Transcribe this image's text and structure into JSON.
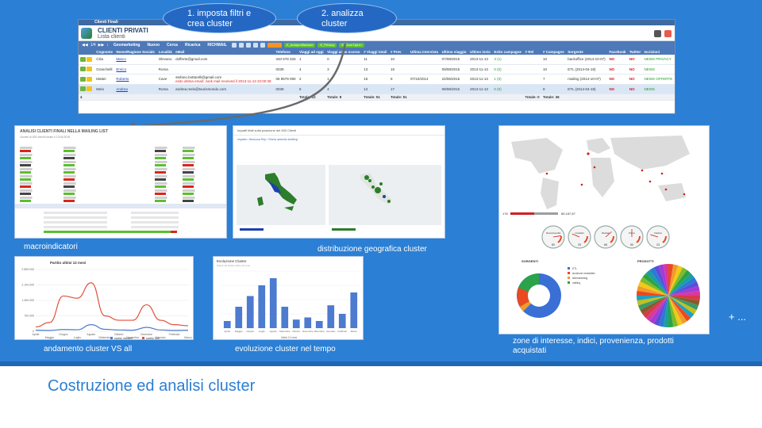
{
  "callouts": {
    "step1": "1. imposta filtri e crea cluster",
    "step2": "2. analizza cluster"
  },
  "crm": {
    "window_title": "Clienti Finali",
    "heading": "CLIENTI PRIVATI",
    "subheading": "Lista clienti",
    "toolbar": {
      "count": "1/4",
      "items": [
        "Geomarketing",
        "Nuovo",
        "Cerca",
        "Ricarica",
        "RICHMAIL"
      ],
      "buttons": [
        "E_Autoprofilazione",
        "E_Privacy",
        "E_Dual Opt-in"
      ]
    },
    "columns": [
      "Cognome",
      "Nome/Ragione Sociale",
      "Località",
      "eMail",
      "Telefono",
      "Viaggi ad oggi",
      "Viaggi anno scorso",
      "# Viaggi totali",
      "# Prev",
      "Ultima intervista",
      "Ultimo viaggio",
      "Ultimo invio",
      "Esito campagne",
      "# Rel",
      "# Campagne",
      "Sorgente",
      "Facebook",
      "Twitter",
      "Iscrizioni"
    ],
    "rows": [
      {
        "cognome": "Cilia",
        "nome": "Marco",
        "localita": "Olevano",
        "email": "dofferte@gmail.com",
        "email2": "",
        "telefono": "340 678 333",
        "oggi": "1",
        "scorso": "0",
        "totali": "11",
        "prev": "10",
        "intervista": "",
        "ultimo_viaggio": "07/08/2015",
        "ultimo_invio": "2013-11-13",
        "esito": "3 (1)",
        "rel": "",
        "campagne": "10",
        "sorgente": "backoffice (2014-10-07)",
        "facebook": "NO",
        "twitter": "NO",
        "iscrizioni": "NEWS PRIVACY"
      },
      {
        "cognome": "Granchelli",
        "nome": "Enrico",
        "localita": "Roma",
        "email": "",
        "email2": "",
        "telefono": "0039",
        "oggi": "4",
        "scorso": "3",
        "totali": "13",
        "prev": "15",
        "intervista": "",
        "ultimo_viaggio": "09/08/2015",
        "ultimo_invio": "2013-11-13",
        "esito": "0 (0)",
        "rel": "",
        "campagne": "10",
        "sorgente": "ETL (2014-04-18)",
        "facebook": "NO",
        "twitter": "NO",
        "iscrizioni": "NEWS"
      },
      {
        "cognome": "Mattei",
        "nome": "Roberto",
        "localita": "Cave",
        "email": "stefano.bottarelli@gmail.com",
        "email2": "esito ultima email: Junk mail received il 2013-11-13 22:00:39",
        "telefono": "06 9579 090",
        "oggi": "2",
        "scorso": "1",
        "totali": "15",
        "prev": "9",
        "intervista": "07/10/2014",
        "ultimo_viaggio": "22/06/2015",
        "ultimo_invio": "2013-11-13",
        "esito": "1 (0)",
        "rel": "",
        "campagne": "7",
        "sorgente": "mailing (2014-10-07)",
        "facebook": "NO",
        "twitter": "NO",
        "iscrizioni": "NEWS OFFERTE"
      },
      {
        "cognome": "Melo",
        "nome": "Andrea",
        "localita": "Roma",
        "email": "andrea.melo@tourismondo.com",
        "email2": "",
        "telefono": "0039",
        "oggi": "5",
        "scorso": "4",
        "totali": "12",
        "prev": "17",
        "intervista": "",
        "ultimo_viaggio": "09/08/2015",
        "ultimo_invio": "2013-11-13",
        "esito": "0 (0)",
        "rel": "",
        "campagne": "9",
        "sorgente": "ETL (2014-04-18)",
        "facebook": "NO",
        "twitter": "NO",
        "iscrizioni": "NEWS"
      }
    ],
    "totals": {
      "count": "4",
      "oggi": "Totale: 12",
      "scorso": "Totale: 8",
      "totali": "Totale: 51",
      "prev": "Totale: 51",
      "rel": "Totale: 0",
      "campagne": "Totale: 36"
    }
  },
  "macro": {
    "title": "ANALISI CLIENTI FINALI NELLA MAILING LIST",
    "subtitle": "Cluster di 500 clienti creato il 12/01/2015",
    "caption": "macroindicatori"
  },
  "geo": {
    "title": "Impatti Mail sulla posizione dei 500 Clienti",
    "legend": [
      "Impatto",
      "Nessuna Rep",
      "Sfonsi azienda dwelling"
    ],
    "caption": "distribuzione geografica cluster"
  },
  "trend": {
    "caption": "andamento cluster VS all",
    "chart_data": {
      "type": "line",
      "title": "Partito ultimi 12 mesi",
      "categories": [
        "Aprile",
        "Maggio",
        "Giugno",
        "Luglio",
        "Agosto",
        "Settembre",
        "Ottobre",
        "Novembre",
        "Dicembre",
        "Gennaio",
        "Febbraio",
        "Marzo"
      ],
      "ylim": [
        0,
        2800000
      ],
      "yticks": [
        "2.800.000",
        "2.100.000",
        "1.400.000",
        "700.000",
        "0"
      ],
      "series": [
        {
          "name": "partito (cluster)",
          "color": "#4c7bd0",
          "values": [
            50000,
            40000,
            80000,
            70000,
            300000,
            90000,
            60000,
            50000,
            180000,
            60000,
            40000,
            50000
          ]
        },
        {
          "name": "partito (tot)",
          "color": "#e0513c",
          "values": [
            200000,
            400000,
            1600000,
            1500000,
            2200000,
            700000,
            500000,
            500000,
            1200000,
            500000,
            300000,
            250000
          ]
        }
      ]
    }
  },
  "evolution": {
    "caption": "evoluzione cluster nel tempo",
    "chart_data": {
      "type": "bar",
      "title": "Evoluzione Cluster",
      "subtitle": "Clienti nel cluster ultimi 12 mesi",
      "categories": [
        "Aprile",
        "Maggio",
        "Giugno",
        "Luglio",
        "Agosto",
        "Settembre",
        "Ottobre",
        "Novembre",
        "Dicembre",
        "Gennaio",
        "Febbraio",
        "Marzo"
      ],
      "values": [
        10,
        30,
        45,
        60,
        70,
        30,
        12,
        15,
        10,
        32,
        20,
        50
      ],
      "ylim": [
        0,
        80
      ],
      "xlabel": "Ultimi 12 mesi",
      "color": "#4c7bd0"
    }
  },
  "interests": {
    "caption": "zone di interesse, indici, provenienza, prodotti acquistati",
    "map_legend_min": "178",
    "map_legend_max": "85.187,87",
    "gauges": [
      "Numero/vendita",
      "Contattati",
      "Risultato",
      "Promo",
      "Telefono"
    ],
    "gauge_values": [
      "80",
      "25",
      "68",
      "50",
      "23"
    ],
    "donut_title": "SORGENTI",
    "donut_legend": [
      "ETL",
      "iscrizione newsletter",
      "telemarketing",
      "mailing"
    ],
    "pie_title": "PRODOTTI"
  },
  "more": "+ ...",
  "footer": {
    "title": "Costruzione ed analisi cluster"
  }
}
